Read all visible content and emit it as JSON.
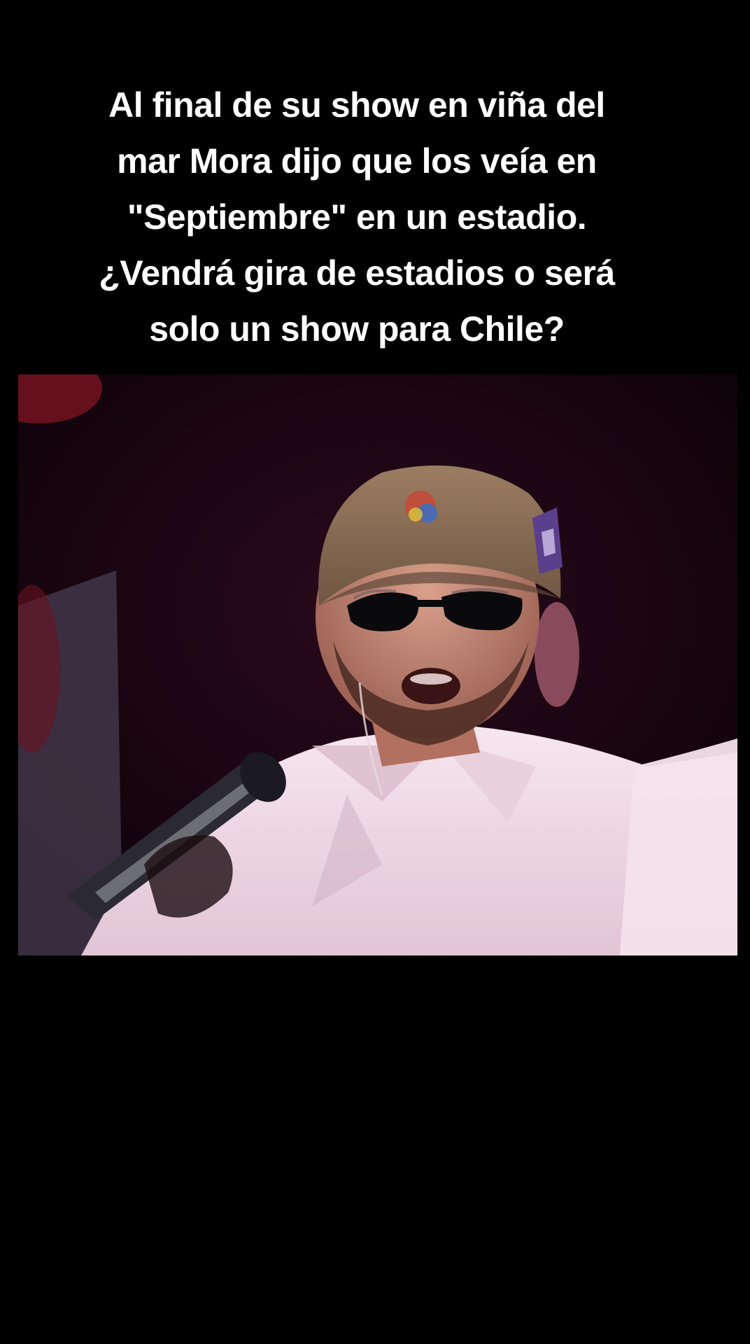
{
  "caption": {
    "lines": [
      "Al final de su show en viña del",
      "mar Mora dijo que los veía en",
      "\"Septiembre\" en un estadio.",
      "¿Vendrá gira de estadios o será",
      "solo un show para Chile?"
    ]
  },
  "video": {
    "description_icon": "video-frame",
    "colors": {
      "background": "#000000",
      "stage_dark": "#1a0610",
      "shirt": "#f1dbe6",
      "cap": "#8a6f58",
      "caption_text": "#ffffff"
    }
  }
}
